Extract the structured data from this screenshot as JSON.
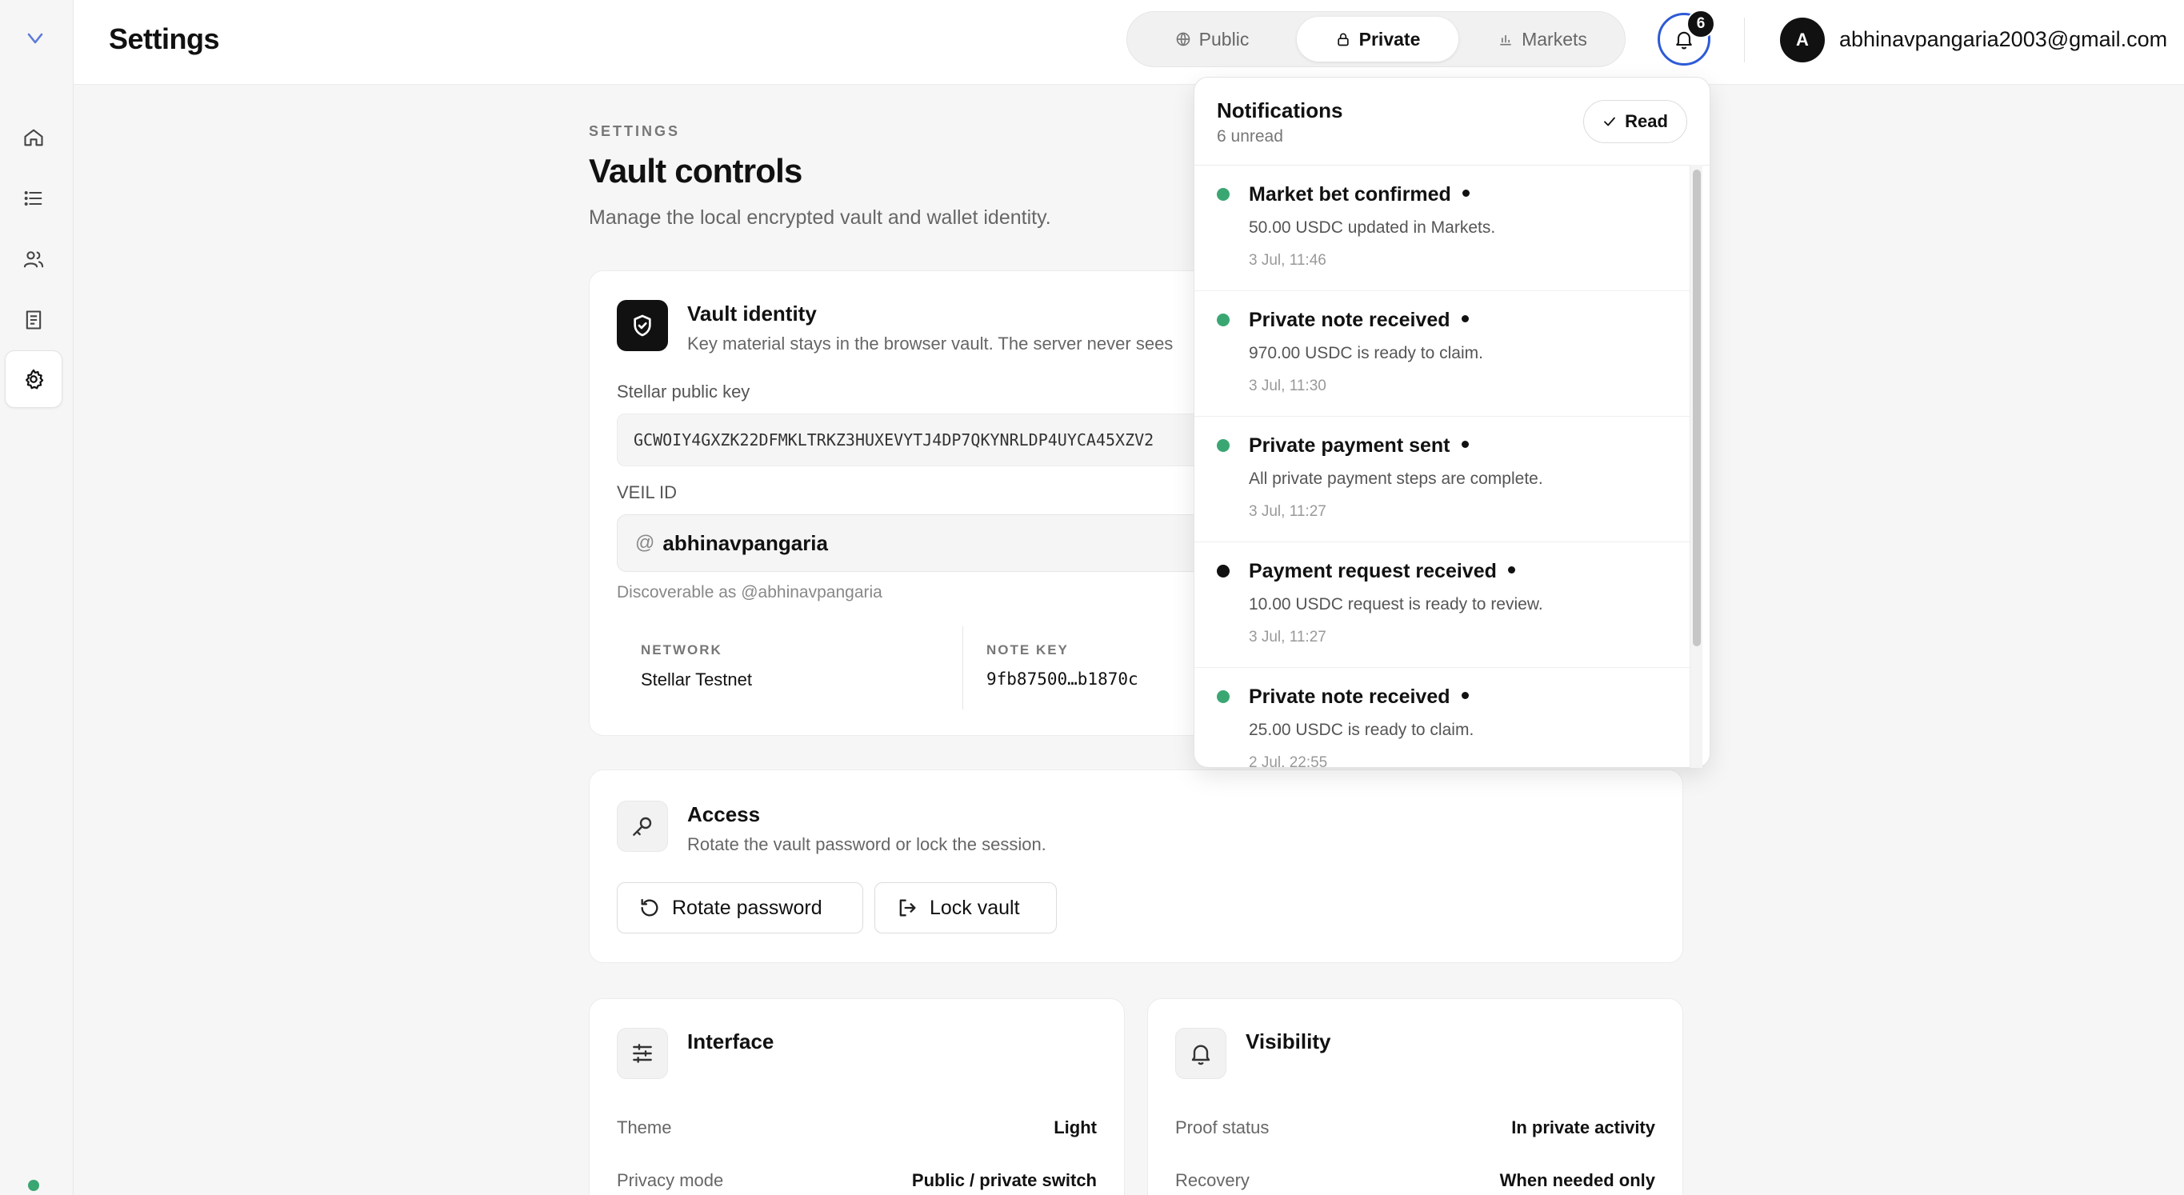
{
  "header": {
    "title": "Settings",
    "modes": [
      {
        "label": "Public",
        "icon": "globe-icon",
        "active": false
      },
      {
        "label": "Private",
        "icon": "lock-icon",
        "active": true
      },
      {
        "label": "Markets",
        "icon": "bar-chart-icon",
        "active": false
      }
    ],
    "notification_badge": "6",
    "avatar_initial": "A",
    "user_email": "abhinavpangaria2003@gmail.com"
  },
  "sidebar": {
    "items": [
      {
        "icon": "home-icon",
        "active": false
      },
      {
        "icon": "list-icon",
        "active": false
      },
      {
        "icon": "users-icon",
        "active": false
      },
      {
        "icon": "document-icon",
        "active": false
      },
      {
        "icon": "gear-icon",
        "active": true
      }
    ],
    "status_color": "#3aa772"
  },
  "main": {
    "eyebrow": "SETTINGS",
    "title": "Vault controls",
    "subtitle": "Manage the local encrypted vault and wallet identity."
  },
  "identity": {
    "title": "Vault identity",
    "description": "Key material stays in the browser vault. The server never sees",
    "public_key_label": "Stellar public key",
    "public_key": "GCWOIY4GXZK22DFMKLTRKZ3HUXEVYTJ4DP7QKYNRLDP4UYCA45XZV2",
    "veil_label": "VEIL ID",
    "veil_prefix": "@",
    "veil_value": "abhinavpangaria",
    "veil_hint": "Discoverable as @abhinavpangaria",
    "network_label": "NETWORK",
    "network_value": "Stellar Testnet",
    "note_key_label": "NOTE KEY",
    "note_key_value": "9fb87500…b1870c"
  },
  "access": {
    "title": "Access",
    "description": "Rotate the vault password or lock the session.",
    "rotate_label": "Rotate password",
    "lock_label": "Lock vault"
  },
  "interface": {
    "title": "Interface",
    "rows": [
      {
        "label": "Theme",
        "value": "Light"
      },
      {
        "label": "Privacy mode",
        "value": "Public / private switch"
      }
    ]
  },
  "visibility": {
    "title": "Visibility",
    "rows": [
      {
        "label": "Proof status",
        "value": "In private activity"
      },
      {
        "label": "Recovery",
        "value": "When needed only"
      }
    ]
  },
  "notifications": {
    "title": "Notifications",
    "count_text": "6 unread",
    "read_label": "Read",
    "items": [
      {
        "title": "Market bet confirmed",
        "body": "50.00 USDC updated in Markets.",
        "time": "3 Jul, 11:46",
        "dot_color": "#3aa772"
      },
      {
        "title": "Private note received",
        "body": "970.00 USDC is ready to claim.",
        "time": "3 Jul, 11:30",
        "dot_color": "#3aa772"
      },
      {
        "title": "Private payment sent",
        "body": "All private payment steps are complete.",
        "time": "3 Jul, 11:27",
        "dot_color": "#3aa772"
      },
      {
        "title": "Payment request received",
        "body": "10.00 USDC request is ready to review.",
        "time": "3 Jul, 11:27",
        "dot_color": "#111111"
      },
      {
        "title": "Private note received",
        "body": "25.00 USDC is ready to claim.",
        "time": "2 Jul, 22:55",
        "dot_color": "#3aa772"
      }
    ]
  },
  "colors": {
    "accent_ring": "#2d5bd6",
    "success": "#3aa772",
    "dark": "#111111"
  }
}
